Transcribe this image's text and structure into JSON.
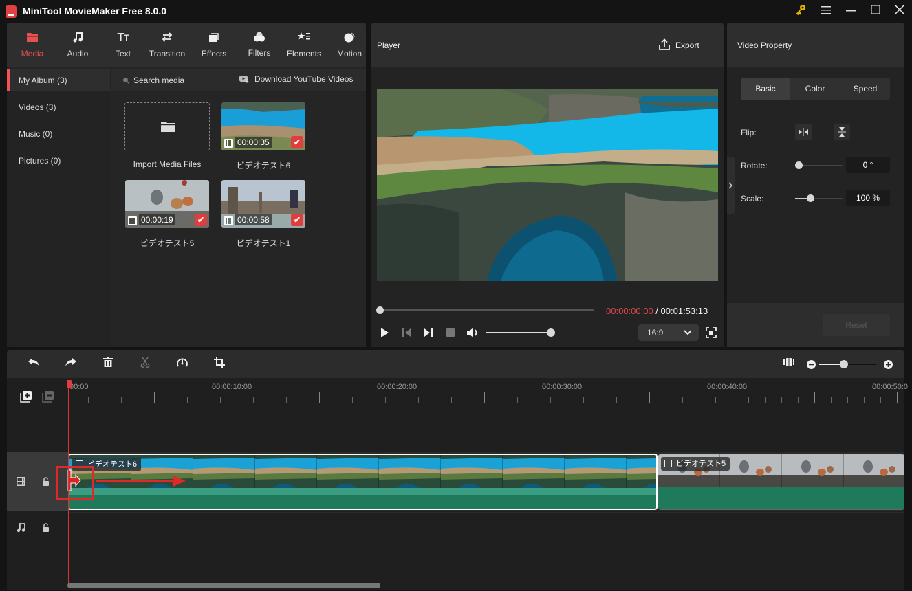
{
  "app": {
    "title": "MiniTool MovieMaker Free 8.0.0"
  },
  "window_controls": {
    "key": "key-icon",
    "menu": "menu-icon",
    "minimize": "minimize-icon",
    "maximize": "maximize-icon",
    "close": "close-icon"
  },
  "toolbar": {
    "items": [
      {
        "label": "Media",
        "icon": "folder-icon",
        "active": true
      },
      {
        "label": "Audio",
        "icon": "music-icon"
      },
      {
        "label": "Text",
        "icon": "text-icon"
      },
      {
        "label": "Transition",
        "icon": "transition-icon"
      },
      {
        "label": "Effects",
        "icon": "effects-icon"
      },
      {
        "label": "Filters",
        "icon": "filters-icon"
      },
      {
        "label": "Elements",
        "icon": "elements-icon"
      },
      {
        "label": "Motion",
        "icon": "motion-icon"
      }
    ]
  },
  "sidebar": {
    "items": [
      {
        "label": "My Album (3)",
        "active": true
      },
      {
        "label": "Videos (3)"
      },
      {
        "label": "Music (0)"
      },
      {
        "label": "Pictures (0)"
      }
    ]
  },
  "media": {
    "search_placeholder": "Search media",
    "download_label": "Download YouTube Videos",
    "import_label": "Import Media Files",
    "files": [
      {
        "name": "ビデオテスト6",
        "duration": "00:00:35",
        "selected": true
      },
      {
        "name": "ビデオテスト5",
        "duration": "00:00:19",
        "selected": true
      },
      {
        "name": "ビデオテスト1",
        "duration": "00:00:58",
        "selected": true
      }
    ]
  },
  "player": {
    "title": "Player",
    "export_label": "Export",
    "current_time": "00:00:00:00",
    "separator": " / ",
    "total_time": "00:01:53:13",
    "progress": 0,
    "volume": 1.0,
    "aspect_ratio": "16:9"
  },
  "property": {
    "title": "Video Property",
    "tabs": [
      "Basic",
      "Color",
      "Speed"
    ],
    "active_tab": "Basic",
    "flip_label": "Flip:",
    "rotate_label": "Rotate:",
    "rotate_value": "0 °",
    "scale_label": "Scale:",
    "scale_value": "100 %",
    "reset_label": "Reset"
  },
  "timeline": {
    "zoom_level": 0.5,
    "ruler_labels": [
      "00:00",
      "00:00:10:00",
      "00:00:20:00",
      "00:00:30:00",
      "00:00:40:00",
      "00:00:50:0"
    ],
    "clips": [
      {
        "name": "ビデオテスト6",
        "selected": true
      },
      {
        "name": "ビデオテスト5"
      }
    ]
  },
  "colors": {
    "accent": "#e23c3c",
    "audio_wave": "#1e7a5a",
    "audio_wave_light": "#3a9c80"
  }
}
